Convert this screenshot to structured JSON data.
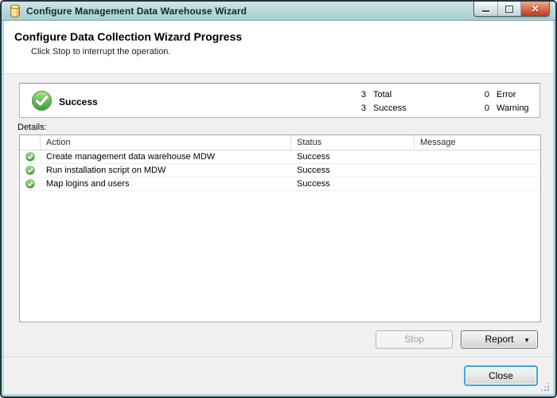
{
  "window": {
    "title": "Configure Management Data Warehouse Wizard",
    "icons": {
      "close_glyph": "✕",
      "report_dropdown": "▼"
    }
  },
  "header": {
    "title": "Configure Data Collection Wizard Progress",
    "subtitle": "Click Stop to interrupt the operation."
  },
  "summary": {
    "status_label": "Success",
    "stats": [
      {
        "value": "3",
        "label": "Total"
      },
      {
        "value": "3",
        "label": "Success"
      },
      {
        "value": "0",
        "label": "Error"
      },
      {
        "value": "0",
        "label": "Warning"
      }
    ]
  },
  "details": {
    "label": "Details:",
    "columns": [
      "Action",
      "Status",
      "Message"
    ],
    "rows": [
      {
        "action": "Create management data warehouse MDW",
        "status": "Success",
        "message": ""
      },
      {
        "action": "Run installation script on MDW",
        "status": "Success",
        "message": ""
      },
      {
        "action": "Map logins and users",
        "status": "Success",
        "message": ""
      }
    ]
  },
  "buttons": {
    "stop": "Stop",
    "report": "Report",
    "close": "Close"
  }
}
